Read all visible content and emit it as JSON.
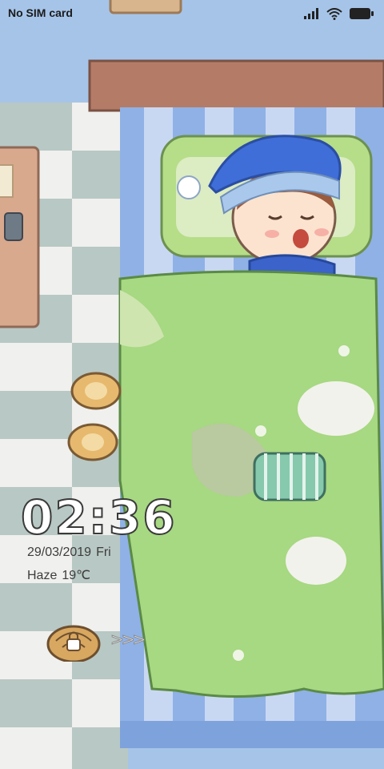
{
  "status_bar": {
    "carrier": "No SIM card",
    "icons": [
      "signal-icon",
      "wifi-icon",
      "battery-icon"
    ]
  },
  "lock_screen": {
    "time": "02:36",
    "date": "29/03/2019",
    "weekday": "Fri",
    "weather_condition": "Haze",
    "temperature": "19℃",
    "unlock_icon": "lock-icon",
    "swipe_hint": ">>>"
  },
  "colors": {
    "wall": "#9fc1e6",
    "bed_frame": "#b47c67",
    "blanket": "#a7d882",
    "sheet": "#a9c6f0",
    "text": "#3d3d3d"
  }
}
